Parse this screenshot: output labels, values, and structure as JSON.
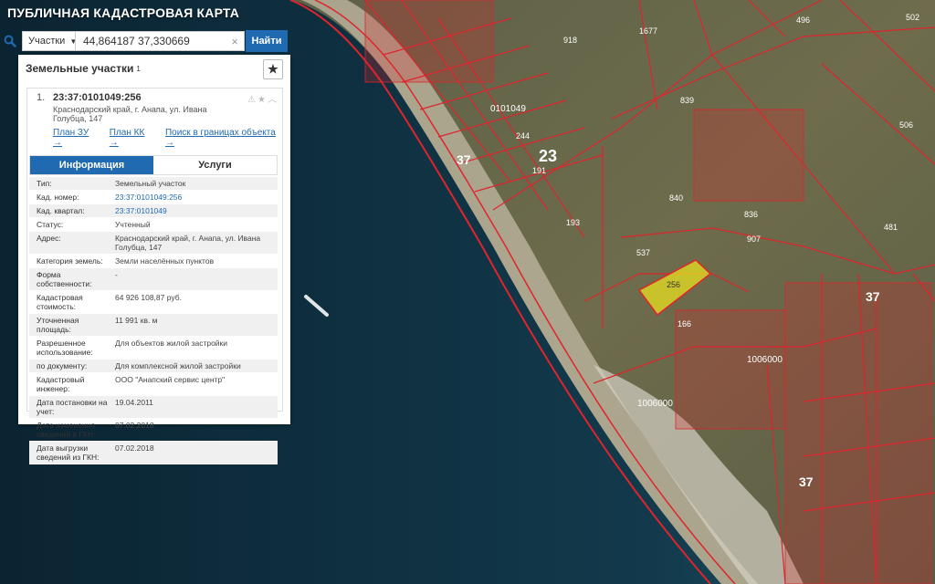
{
  "app": {
    "title": "ПУБЛИЧНАЯ КАДАСТРОВАЯ КАРТА"
  },
  "search": {
    "type_label": "Участки",
    "query": "44,864187 37,330669",
    "find_label": "Найти"
  },
  "panel": {
    "title": "Земельные участки",
    "count": "1",
    "item": {
      "index": "1.",
      "cadastral_number": "23:37:0101049:256",
      "address": "Краснодарский край, г. Анапа, ул. Ивана Голубца, 147",
      "links": [
        "План ЗУ →",
        "План КК →",
        "Поиск в границах объекта →"
      ],
      "tabs": [
        {
          "label": "Информация",
          "active": true
        },
        {
          "label": "Услуги",
          "active": false
        }
      ],
      "fields": [
        {
          "label": "Тип:",
          "value": "Земельный участок"
        },
        {
          "label": "Кад. номер:",
          "value": "23:37:0101049:256",
          "link": true
        },
        {
          "label": "Кад. квартал:",
          "value": "23:37:0101049",
          "link": true
        },
        {
          "label": "Статус:",
          "value": "Учтенный"
        },
        {
          "label": "Адрес:",
          "value": "Краснодарский край, г. Анапа, ул. Ивана Голубца, 147"
        },
        {
          "label": "Категория земель:",
          "value": "Земли населённых пунктов"
        },
        {
          "label": "Форма собственности:",
          "value": "-"
        },
        {
          "label": "Кадастровая стоимость:",
          "value": "64 926 108,87 руб."
        },
        {
          "label": "Уточненная площадь:",
          "value": "11 991 кв. м"
        },
        {
          "label": "Разрешенное использование:",
          "value": "Для объектов жилой застройки"
        },
        {
          "label": "по документу:",
          "value": "Для комплексной жилой застройки"
        },
        {
          "label": "Кадастровый инженер:",
          "value": "ООО \"Анапский сервис центр\""
        },
        {
          "label": "Дата постановки на учет:",
          "value": "19.04.2011"
        },
        {
          "label": "Дата изменения сведений в ГКН:",
          "value": "07.02.2018"
        },
        {
          "label": "Дата выгрузки сведений из ГКН:",
          "value": "07.02.2018"
        }
      ]
    }
  },
  "map": {
    "colors": {
      "sea": "#0d2a3a",
      "land": "#6b6a4a",
      "parcel": "#e0242c",
      "selected": "#e8e020"
    },
    "labels": {
      "quarter_23": "23",
      "quarter_37a": "37",
      "quarter_37b": "37",
      "quarter_37c": "37",
      "block_a": "0101049",
      "block_b": "1006000",
      "block_c": "1006000",
      "selected_parcel": "256",
      "p496": "496",
      "p502": "502",
      "p1677": "1677",
      "p918": "918",
      "p506": "506",
      "p839": "839",
      "p840": "840",
      "p907": "907",
      "p836": "836",
      "p481": "481",
      "p537": "537",
      "p193": "193",
      "p191": "191",
      "p244": "244",
      "p166": "166"
    }
  }
}
